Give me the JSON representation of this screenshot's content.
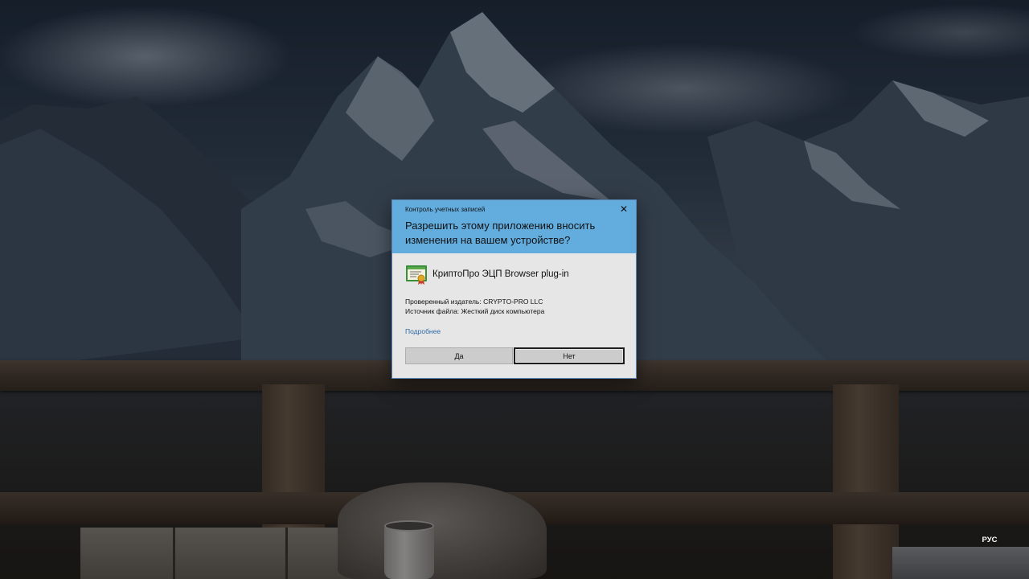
{
  "uac": {
    "title": "Контроль учетных записей",
    "close_symbol": "✕",
    "question": "Разрешить этому приложению вносить изменения на вашем устройстве?",
    "app_name": "КриптоПро ЭЦП Browser plug-in",
    "app_icon": "certificate-icon",
    "publisher": "Проверенный издатель: CRYPTO-PRO LLC",
    "file_source": "Источник файла: Жесткий диск компьютера",
    "more_details": "Подробнее",
    "yes_label": "Да",
    "no_label": "Нет",
    "header_color": "#63acde",
    "body_color": "#e6e6e6"
  },
  "taskbar": {
    "language": "РУС"
  }
}
